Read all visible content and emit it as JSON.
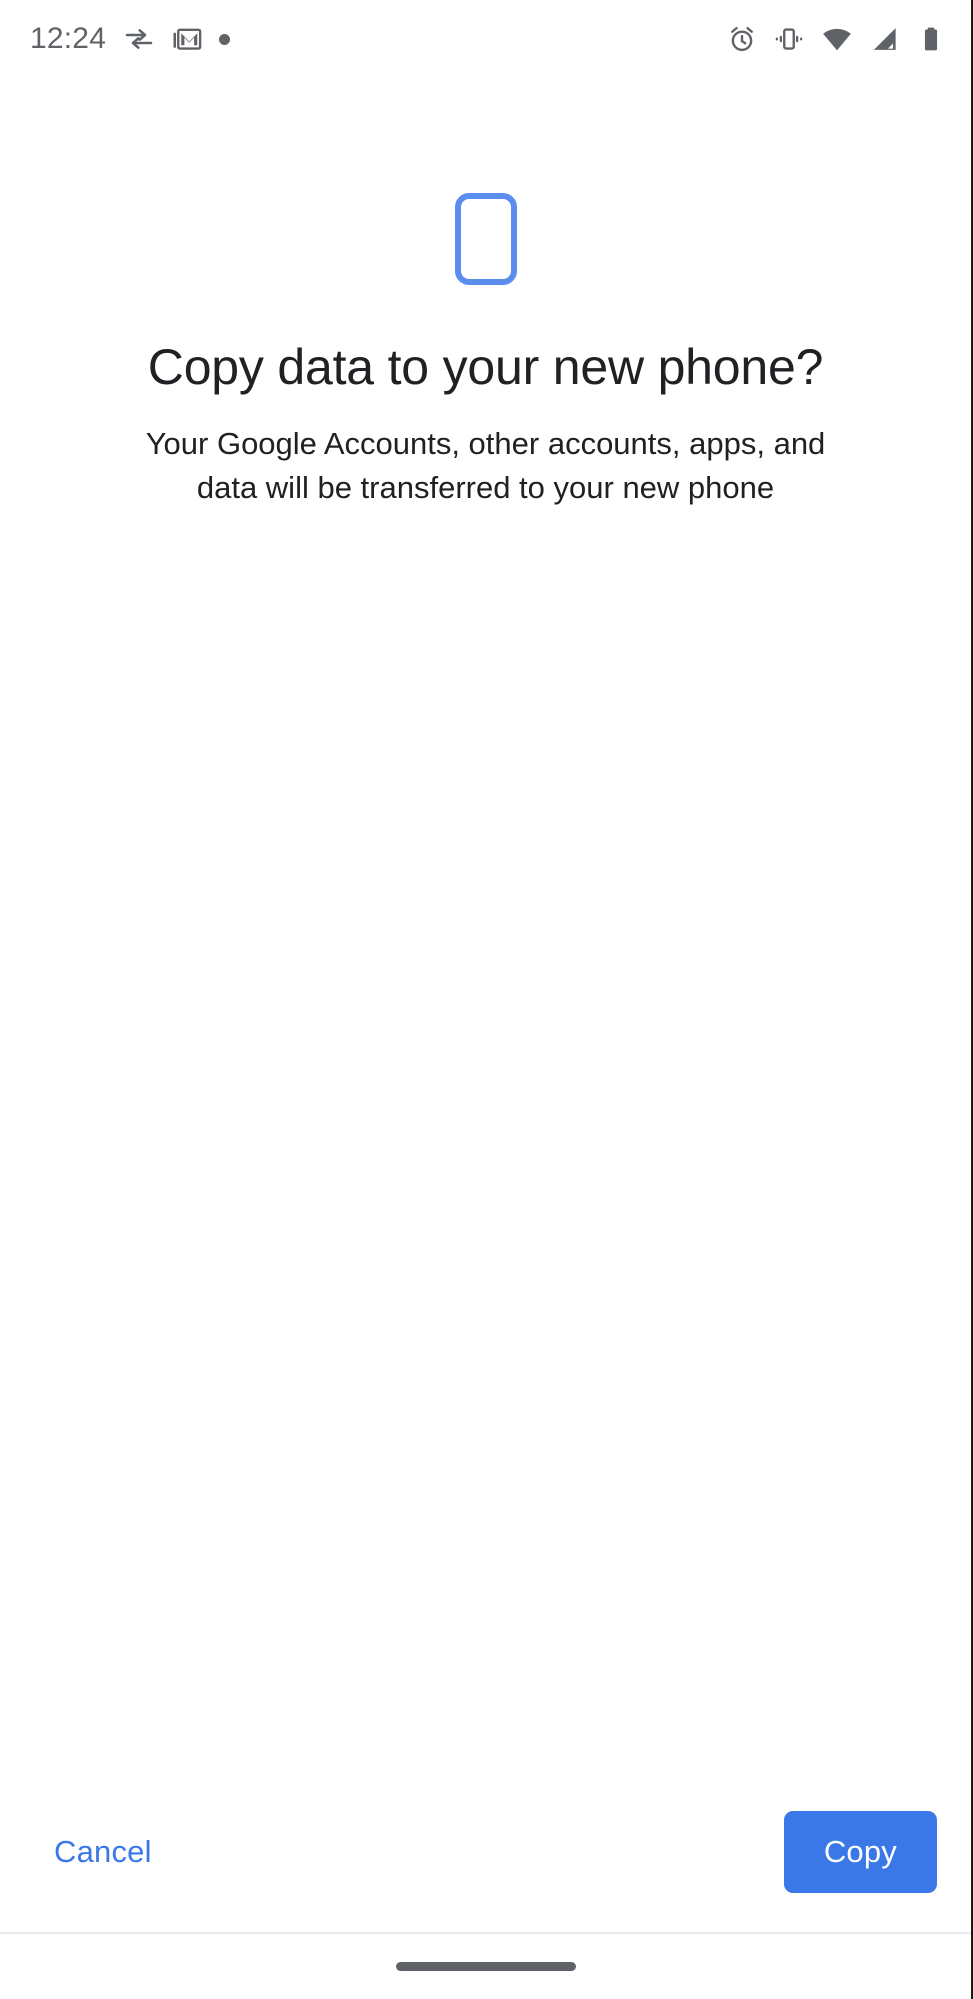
{
  "status_bar": {
    "time": "12:24",
    "left_icons": [
      {
        "name": "data-transfer-icon",
        "label": "Data transfer"
      },
      {
        "name": "gmail-icon",
        "label": "Gmail"
      },
      {
        "name": "notification-dot-icon",
        "label": "Notification"
      }
    ],
    "right_icons": [
      {
        "name": "alarm-clock-icon",
        "label": "Alarm set"
      },
      {
        "name": "vibrate-icon",
        "label": "Vibrate mode"
      },
      {
        "name": "wifi-icon",
        "label": "Wi-Fi"
      },
      {
        "name": "cellular-signal-icon",
        "label": "Cellular signal"
      },
      {
        "name": "battery-icon",
        "label": "Battery"
      }
    ]
  },
  "main": {
    "hero_icon": "smartphone-icon",
    "title": "Copy data to your new phone?",
    "subtitle": "Your Google Accounts, other accounts, apps, and data will be transferred to your new phone"
  },
  "actions": {
    "cancel_label": "Cancel",
    "copy_label": "Copy"
  },
  "navigation": {
    "gesture_pill": "home-gesture-pill"
  },
  "colors": {
    "accent_blue": "#3b78e7",
    "hero_blue": "#5b8def",
    "text_primary": "#202124",
    "status_gray": "#5f6368",
    "divider": "#e8eaed",
    "background": "#ffffff"
  }
}
